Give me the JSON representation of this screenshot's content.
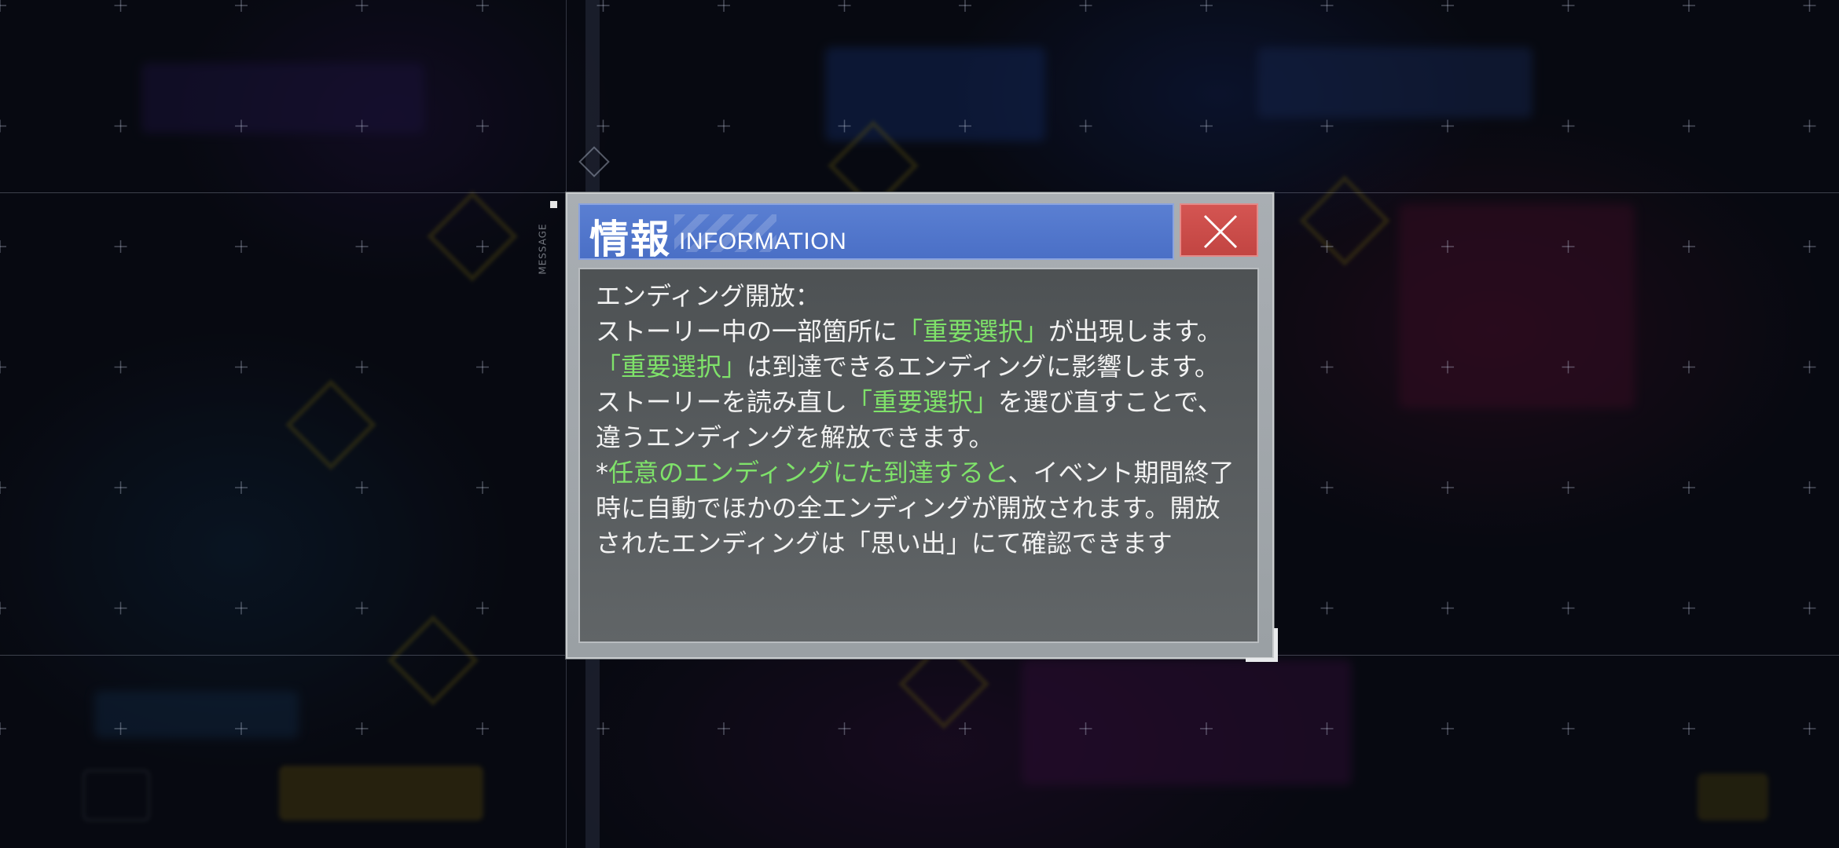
{
  "side_label": "MESSAGE",
  "dialog": {
    "title_jp": "情報",
    "title_en": "INFORMATION",
    "close_icon": "close-x-icon",
    "lines": [
      [
        {
          "t": "エンディング開放：",
          "hl": false
        }
      ],
      [
        {
          "t": "ストーリー中の一部箇所に",
          "hl": false
        },
        {
          "t": "「重要選択」",
          "hl": true
        },
        {
          "t": "が出現します。",
          "hl": false
        }
      ],
      [
        {
          "t": "「重要選択」",
          "hl": true
        },
        {
          "t": "は到達できるエンディングに影響します。",
          "hl": false
        }
      ],
      [
        {
          "t": "ストーリーを読み直し",
          "hl": false
        },
        {
          "t": "「重要選択」",
          "hl": true
        },
        {
          "t": "を選び直すことで、",
          "hl": false
        }
      ],
      [
        {
          "t": "違うエンディングを解放できます。",
          "hl": false
        }
      ],
      [
        {
          "t": "*",
          "hl": false
        },
        {
          "t": "任意のエンディングにた到達すると",
          "hl": true
        },
        {
          "t": "、イベント期間終了",
          "hl": false
        }
      ],
      [
        {
          "t": "時に自動でほかの全エンディングが開放されます。開放",
          "hl": false
        }
      ],
      [
        {
          "t": "されたエンディングは「思い出」にて確認できます",
          "hl": false
        }
      ]
    ]
  },
  "colors": {
    "highlight": "#7fe26a",
    "title_bar": "#4a6fc6",
    "close_button": "#c24542"
  }
}
